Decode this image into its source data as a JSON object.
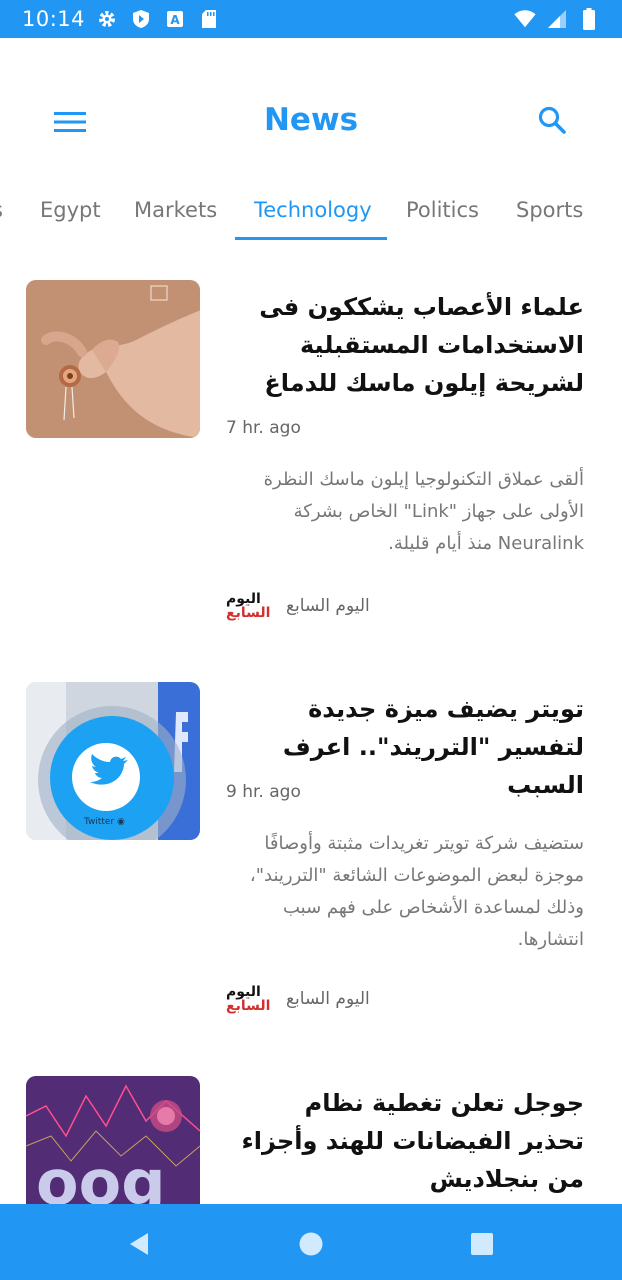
{
  "status_bar": {
    "time": "10:14",
    "icons_left": [
      "settings-icon",
      "shield-icon",
      "a-badge-icon",
      "sd-card-icon"
    ],
    "icons_right": [
      "wifi-icon",
      "signal-icon",
      "battery-icon"
    ],
    "background": "#2196f3"
  },
  "app_bar": {
    "title": "News",
    "menu_icon": "hamburger-menu-icon",
    "search_icon": "search-icon",
    "accent": "#2196f3"
  },
  "tabs": {
    "items": [
      {
        "label": "s"
      },
      {
        "label": "Egypt"
      },
      {
        "label": "Markets"
      },
      {
        "label": "Technology"
      },
      {
        "label": "Politics"
      },
      {
        "label": "Sports"
      }
    ],
    "active_index": 3
  },
  "articles": [
    {
      "headline": "علماء الأعصاب يشككون فى الاستخدامات المستقبلية لشريحة إيلون ماسك للدماغ",
      "time": "7 hr. ago",
      "excerpt": "ألقى عملاق التكنولوجيا إيلون ماسك النظرة الأولى على جهاز \"Link\" الخاص بشركة Neuralink منذ أيام قليلة.",
      "source_name": "اليوم السابع",
      "source_logo_line1": "اليوم",
      "source_logo_line2": "السابع",
      "thumbnail": "neuralink-chip-image"
    },
    {
      "headline": "تويتر يضيف ميزة جديدة لتفسير \"الترريند\".. اعرف السبب",
      "time": "9 hr. ago",
      "excerpt": "ستضيف شركة تويتر تغريدات مثبتة وأوصافًا موجزة لبعض الموضوعات الشائعة \"الترريند\"، وذلك لمساعدة الأشخاص على فهم سبب انتشارها.",
      "source_name": "اليوم السابع",
      "source_logo_line1": "اليوم",
      "source_logo_line2": "السابع",
      "thumbnail": "twitter-logo-image"
    },
    {
      "headline": "جوجل تعلن تغطية نظام تحذير الفيضانات للهند وأجزاء من بنجلاديش",
      "thumbnail": "google-virus-image"
    }
  ],
  "nav_bar": {
    "buttons": [
      "back-icon",
      "home-icon",
      "recents-icon"
    ],
    "background": "#2196f3"
  }
}
